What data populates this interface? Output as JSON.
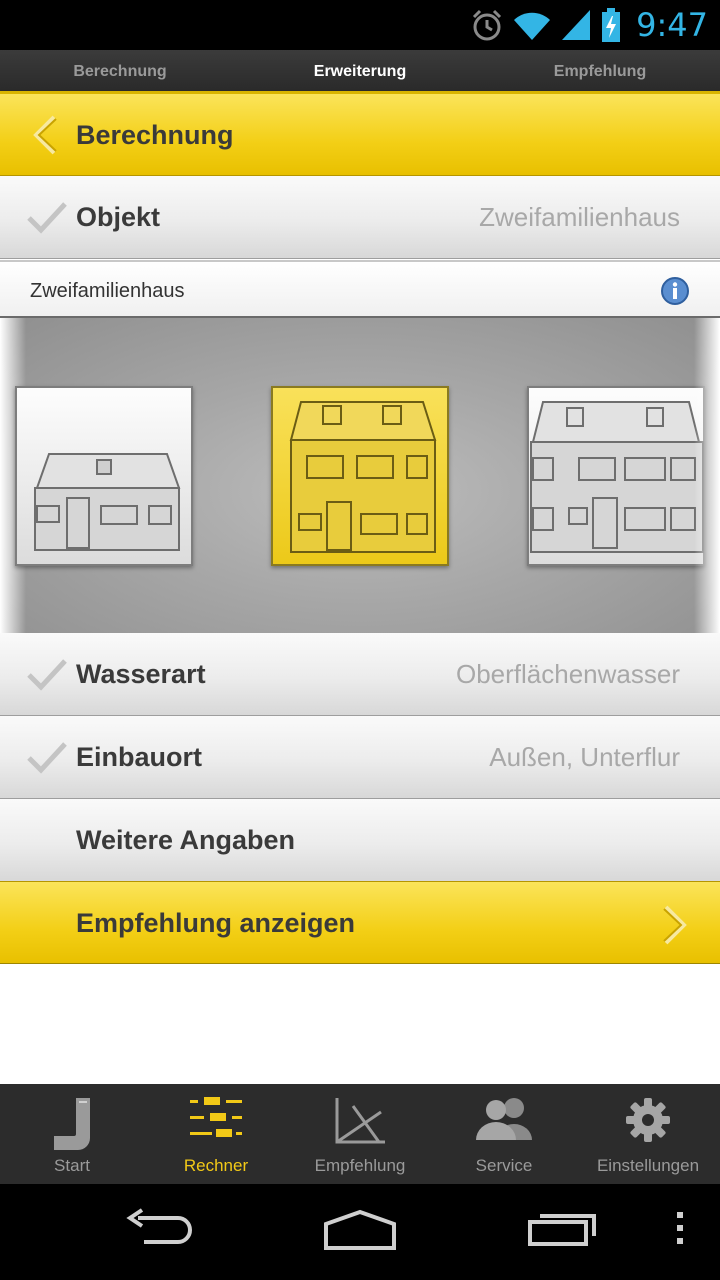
{
  "status_bar": {
    "time": "9:47",
    "icons": [
      "alarm-icon",
      "wifi-icon",
      "signal-icon",
      "battery-charging-icon"
    ]
  },
  "top_tabs": [
    {
      "label": "Berechnung",
      "active": false
    },
    {
      "label": "Erweiterung",
      "active": true
    },
    {
      "label": "Empfehlung",
      "active": false
    }
  ],
  "header": {
    "title": "Berechnung",
    "back_icon": "chevron-left-icon"
  },
  "rows": {
    "objekt": {
      "label": "Objekt",
      "value": "Zweifamilienhaus",
      "checked": true
    },
    "subheader": {
      "label": "Zweifamilienhaus",
      "icon": "info-icon"
    },
    "wasserart": {
      "label": "Wasserart",
      "value": "Oberflächenwasser",
      "checked": true
    },
    "einbauort": {
      "label": "Einbauort",
      "value": "Außen, Unterflur",
      "checked": true
    },
    "weitere": {
      "label": "Weitere Angaben"
    },
    "empfehlung": {
      "label": "Empfehlung anzeigen",
      "icon": "chevron-right-icon"
    }
  },
  "carousel": {
    "items": [
      {
        "name": "Einfamilienhaus",
        "selected": false
      },
      {
        "name": "Zweifamilienhaus",
        "selected": true
      },
      {
        "name": "Mehrfamilienhaus",
        "selected": false
      }
    ]
  },
  "bottom_nav": [
    {
      "label": "Start",
      "icon": "start-pipe-icon",
      "active": false
    },
    {
      "label": "Rechner",
      "icon": "calculator-sliders-icon",
      "active": true
    },
    {
      "label": "Empfehlung",
      "icon": "recommendation-chart-icon",
      "active": false
    },
    {
      "label": "Service",
      "icon": "people-icon",
      "active": false
    },
    {
      "label": "Einstellungen",
      "icon": "gear-icon",
      "active": false
    }
  ],
  "colors": {
    "accent": "#f2c917",
    "status_time": "#33b5e5"
  }
}
